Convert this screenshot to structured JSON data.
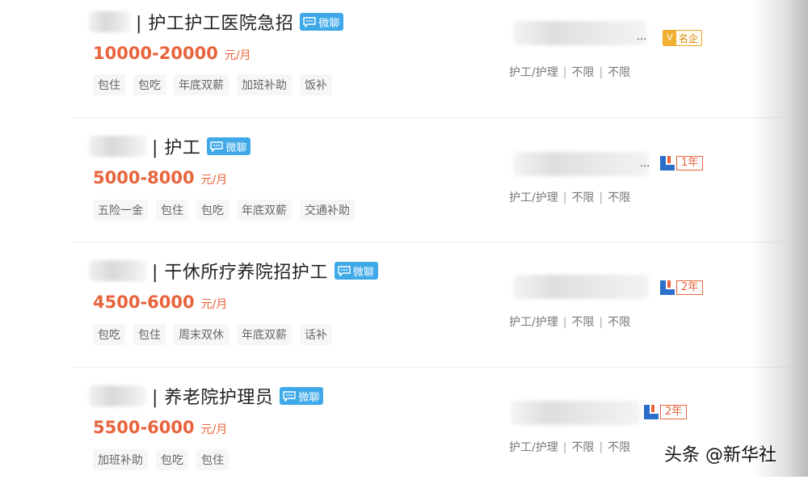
{
  "listings": [
    {
      "title": "| 护工护工医院急招",
      "chat_label": "微聊",
      "salary": "10000-20000",
      "salary_unit": "元/月",
      "tags": [
        "包住",
        "包吃",
        "年底双薪",
        "加班补助",
        "饭补"
      ],
      "company_ellipsis": "...",
      "badge_type": "mingqi",
      "badge_text": "名企",
      "badge_icon": "v-icon",
      "meta": [
        "护工/护理",
        "不限",
        "不限"
      ],
      "meta_separator": "|"
    },
    {
      "title": "| 护工",
      "chat_label": "微聊",
      "salary": "5000-8000",
      "salary_unit": "元/月",
      "tags": [
        "五险一金",
        "包住",
        "包吃",
        "年底双薪",
        "交通补助"
      ],
      "company_ellipsis": "...",
      "badge_type": "year",
      "badge_text": "1年",
      "badge_icon": "membership-icon",
      "meta": [
        "护工/护理",
        "不限",
        "不限"
      ],
      "meta_separator": "|"
    },
    {
      "title": "| 干休所疗养院招护工",
      "chat_label": "微聊",
      "salary": "4500-6000",
      "salary_unit": "元/月",
      "tags": [
        "包吃",
        "包住",
        "周末双休",
        "年底双薪",
        "话补"
      ],
      "company_ellipsis": "",
      "badge_type": "year",
      "badge_text": "2年",
      "badge_icon": "membership-icon",
      "meta": [
        "护工/护理",
        "不限",
        "不限"
      ],
      "meta_separator": "|"
    },
    {
      "title": "| 养老院护理员",
      "chat_label": "微聊",
      "salary": "5500-6000",
      "salary_unit": "元/月",
      "tags": [
        "加班补助",
        "包吃",
        "包住"
      ],
      "company_ellipsis": "",
      "badge_type": "year",
      "badge_text": "2年",
      "badge_icon": "membership-icon",
      "meta": [
        "护工/护理",
        "不限",
        "不限"
      ],
      "meta_separator": "|"
    }
  ],
  "watermark": "头条 @新华社",
  "colors": {
    "salary": "#e8643c",
    "chat_badge": "#3fa9e8",
    "mingqi_badge": "#f0b131",
    "year_badge": "#e8643c",
    "year_icon_blue": "#2a6fc9"
  }
}
